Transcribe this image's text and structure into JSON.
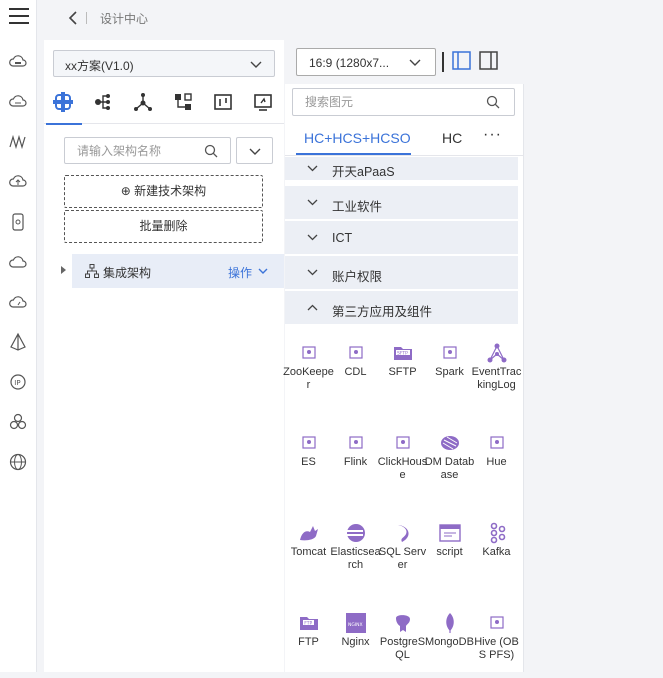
{
  "header": {
    "breadcrumb": "设计中心"
  },
  "scheme": {
    "selected": "xx方案(V1.0)"
  },
  "tool_tabs": [
    "architecture-icon",
    "tree-icon",
    "network-icon",
    "flow-icon",
    "chart-board-icon",
    "monitor-icon"
  ],
  "arch_search": {
    "placeholder": "请输入架构名称"
  },
  "actions": {
    "new_arch": "⊕ 新建技术架构",
    "batch_delete": "批量删除"
  },
  "tree": {
    "label": "集成架构",
    "op": "操作"
  },
  "canvas_toolbar": {
    "ratio": "16:9 (1280x7..."
  },
  "element_search": {
    "placeholder": "搜索图元"
  },
  "cloud_tabs": [
    "HC+HCS+HCSO",
    "HC"
  ],
  "more": "···",
  "categories": [
    {
      "label": "开天aPaaS",
      "expanded": false
    },
    {
      "label": "工业软件",
      "expanded": false
    },
    {
      "label": "ICT",
      "expanded": false
    },
    {
      "label": "账户权限",
      "expanded": false
    },
    {
      "label": "第三方应用及组件",
      "expanded": true
    }
  ],
  "elements": [
    {
      "label": "ZooKeeper",
      "icon": "zookeeper-icon"
    },
    {
      "label": "CDL",
      "icon": "cdl-icon"
    },
    {
      "label": "SFTP",
      "icon": "sftp-icon"
    },
    {
      "label": "Spark",
      "icon": "spark-icon"
    },
    {
      "label": "EventTrackingLog",
      "icon": "event-tracking-icon"
    },
    {
      "label": "ES",
      "icon": "es-icon"
    },
    {
      "label": "Flink",
      "icon": "flink-icon"
    },
    {
      "label": "ClickHouse",
      "icon": "clickhouse-icon"
    },
    {
      "label": "DM Database",
      "icon": "dm-database-icon"
    },
    {
      "label": "Hue",
      "icon": "hue-icon"
    },
    {
      "label": "Tomcat",
      "icon": "tomcat-icon"
    },
    {
      "label": "Elasticsearch",
      "icon": "elasticsearch-icon"
    },
    {
      "label": "SQL Server",
      "icon": "sql-server-icon"
    },
    {
      "label": "script",
      "icon": "script-icon"
    },
    {
      "label": "Kafka",
      "icon": "kafka-icon"
    },
    {
      "label": "FTP",
      "icon": "ftp-icon"
    },
    {
      "label": "Nginx",
      "icon": "nginx-icon"
    },
    {
      "label": "PostgreSQL",
      "icon": "postgresql-icon"
    },
    {
      "label": "MongoDB",
      "icon": "mongodb-icon"
    },
    {
      "label": "Hive (OBS PFS)",
      "icon": "hive-icon"
    }
  ],
  "colors": {
    "accent": "#3b73d9",
    "icon_purple": "#8e6bc6"
  }
}
